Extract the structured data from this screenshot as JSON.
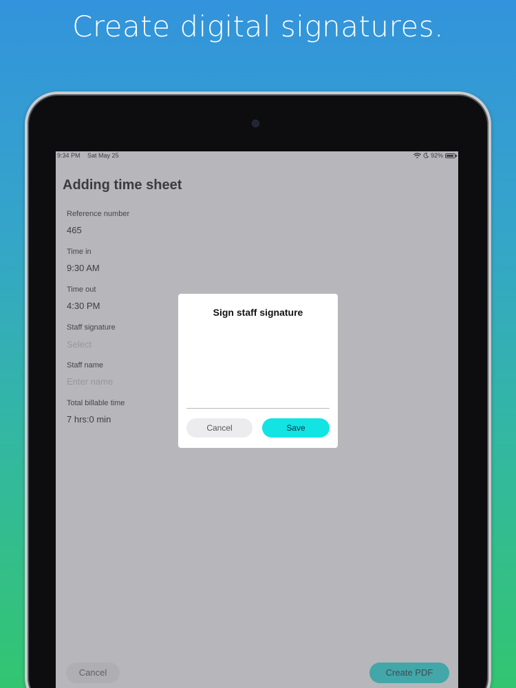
{
  "headline": "Create digital signatures.",
  "status_bar": {
    "time": "9:34 PM",
    "date": "Sat May 25",
    "battery": "92%"
  },
  "page": {
    "title": "Adding time sheet",
    "fields": [
      {
        "label": "Reference number",
        "value": "465"
      },
      {
        "label": "Time in",
        "value": "9:30 AM"
      },
      {
        "label": "Time out",
        "value": "4:30 PM"
      },
      {
        "label": "Staff signature",
        "placeholder": "Select"
      },
      {
        "label": "Staff name",
        "placeholder": "Enter name"
      },
      {
        "label": "Total billable time",
        "value": "7 hrs:0 min"
      }
    ],
    "cancel_label": "Cancel",
    "create_pdf_label": "Create PDF"
  },
  "modal": {
    "title": "Sign staff signature",
    "cancel_label": "Cancel",
    "save_label": "Save"
  },
  "colors": {
    "accent": "#1fd3d4",
    "background_top": "#3393dc",
    "background_bottom": "#33c571"
  },
  "icons": [
    "wifi-icon",
    "moon-icon",
    "battery-icon"
  ]
}
